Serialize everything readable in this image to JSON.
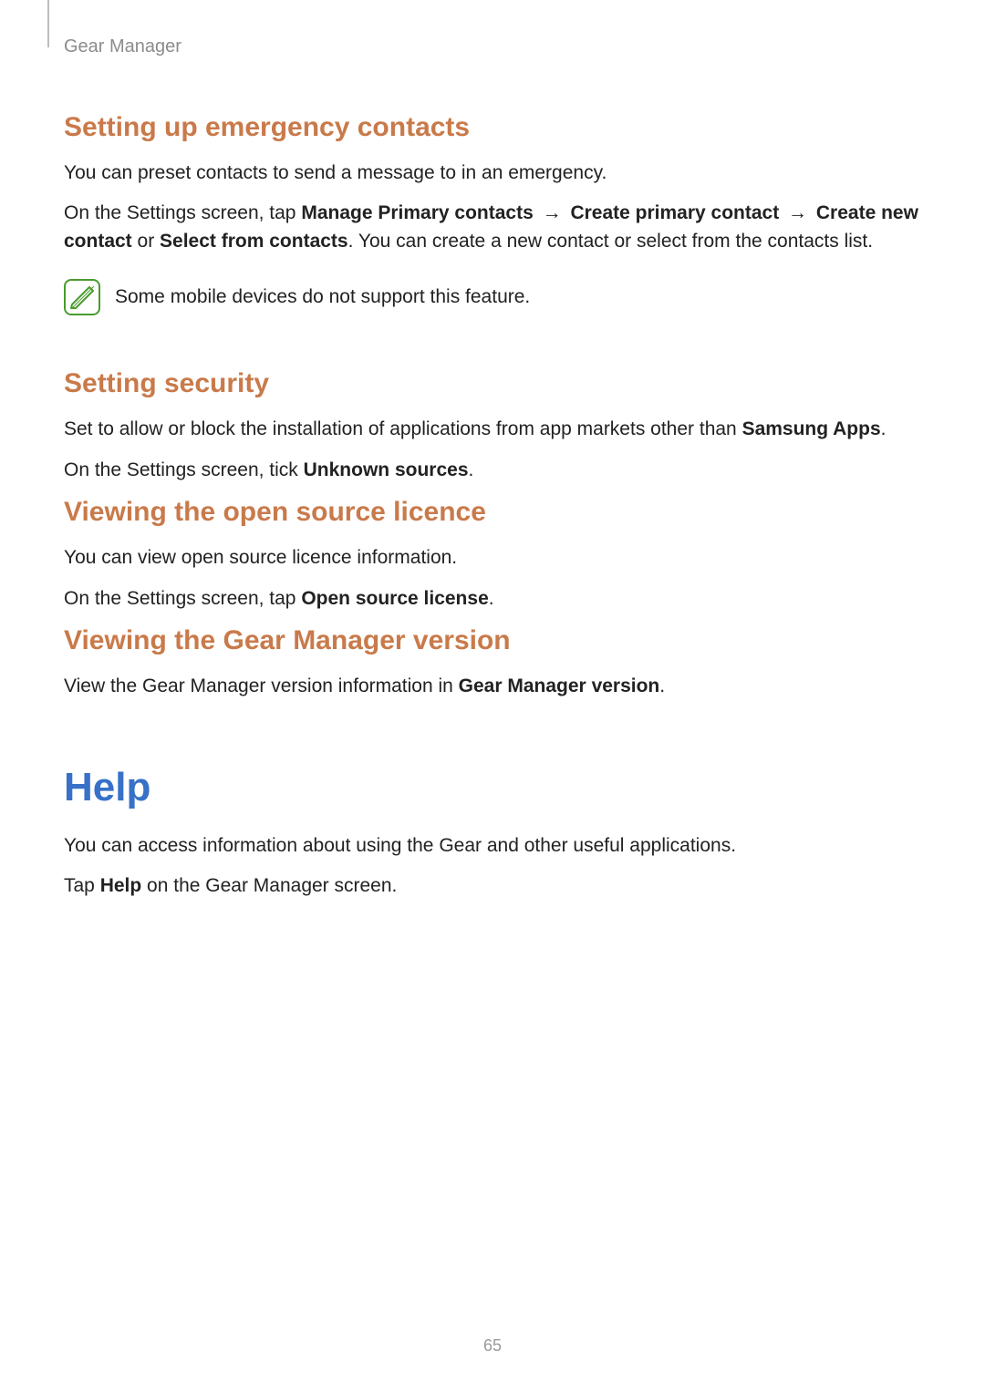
{
  "breadcrumb": "Gear Manager",
  "page_number": "65",
  "sections": {
    "emergency": {
      "heading": "Setting up emergency contacts",
      "p1": "You can preset contacts to send a message to in an emergency.",
      "p2_pre": "On the Settings screen, tap ",
      "p2_b1": "Manage Primary contacts",
      "arrow": " → ",
      "p2_b2": "Create primary contact",
      "p2_b3": "Create new contact",
      "p2_or": " or ",
      "p2_b4": "Select from contacts",
      "p2_post": ". You can create a new contact or select from the contacts list.",
      "note": "Some mobile devices do not support this feature."
    },
    "security": {
      "heading": "Setting security",
      "p1_pre": "Set to allow or block the installation of applications from app markets other than ",
      "p1_b1": "Samsung Apps",
      "p1_post": ".",
      "p2_pre": "On the Settings screen, tick ",
      "p2_b1": "Unknown sources",
      "p2_post": "."
    },
    "licence": {
      "heading": "Viewing the open source licence",
      "p1": "You can view open source licence information.",
      "p2_pre": "On the Settings screen, tap ",
      "p2_b1": "Open source license",
      "p2_post": "."
    },
    "version": {
      "heading": "Viewing the Gear Manager version",
      "p1_pre": "View the Gear Manager version information in ",
      "p1_b1": "Gear Manager version",
      "p1_post": "."
    },
    "help": {
      "heading": "Help",
      "p1": "You can access information about using the Gear and other useful applications.",
      "p2_pre": "Tap ",
      "p2_b1": "Help",
      "p2_post": " on the Gear Manager screen."
    }
  }
}
